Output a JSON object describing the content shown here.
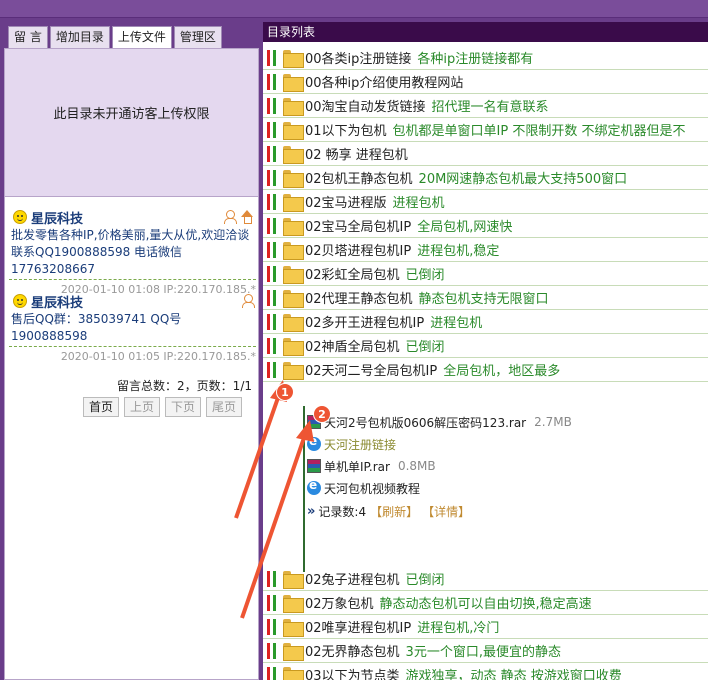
{
  "tabs": [
    {
      "label": "留 言"
    },
    {
      "label": "增加目录"
    },
    {
      "label": "上传文件"
    },
    {
      "label": "管理区"
    }
  ],
  "upload_message": "此目录未开通访客上传权限",
  "messages": [
    {
      "author": "星辰科技",
      "lines": [
        "批发零售各种IP,价格美丽,量大从优,欢迎洽谈",
        "联系QQ1900888598  电话微信17763208667"
      ],
      "meta": "2020-01-10 01:08 IP:220.170.185.*"
    },
    {
      "author": "星辰科技",
      "lines": [
        "售后QQ群：385039741  QQ号1900888598"
      ],
      "meta": "2020-01-10 01:05 IP:220.170.185.*"
    }
  ],
  "stats": "留言总数：2，页数：1/1",
  "pager": {
    "first": "首页",
    "prev": "上页",
    "next": "下页",
    "last": "尾页"
  },
  "right_title": "目录列表",
  "directories": [
    {
      "name": "00各类ip注册链接",
      "desc": "各种ip注册链接都有"
    },
    {
      "name": "00各种ip介绍使用教程网站",
      "desc": ""
    },
    {
      "name": "00淘宝自动发货链接",
      "desc": "招代理一名有意联系"
    },
    {
      "name": "01以下为包机",
      "desc": "包机都是单窗口单IP 不限制开数 不绑定机器但是不"
    },
    {
      "name": "02 畅享 进程包机",
      "desc": ""
    },
    {
      "name": "02包机王静态包机",
      "desc": "20M网速静态包机最大支持500窗口"
    },
    {
      "name": "02宝马进程版",
      "desc": "进程包机"
    },
    {
      "name": "02宝马全局包机IP",
      "desc": "全局包机,网速快"
    },
    {
      "name": "02贝塔进程包机IP",
      "desc": "进程包机,稳定"
    },
    {
      "name": "02彩虹全局包机",
      "desc": "已倒闭"
    },
    {
      "name": "02代理王静态包机",
      "desc": "静态包机支持无限窗口"
    },
    {
      "name": "02多开王进程包机IP",
      "desc": "进程包机"
    },
    {
      "name": "02神盾全局包机",
      "desc": "已倒闭"
    },
    {
      "name": "02天河二号全局包机IP",
      "desc": "全局包机，地区最多"
    }
  ],
  "expanded_files": [
    {
      "name": "天河2号包机版0606解压密码123.rar",
      "size": "2.7MB",
      "icon": "rar-icon"
    },
    {
      "name": "天河注册链接",
      "size": "",
      "icon": "ie-icon"
    },
    {
      "name": "单机单IP.rar",
      "size": "0.8MB",
      "icon": "rar-icon"
    },
    {
      "name": "天河包机视频教程",
      "size": "",
      "icon": "ie-icon"
    }
  ],
  "record": {
    "text": "记录数:4",
    "refresh": "【刷新】",
    "detail": "【详情】"
  },
  "directories2": [
    {
      "name": "02兔子进程包机",
      "desc": "已倒闭"
    },
    {
      "name": "02万象包机",
      "desc": "静态动态包机可以自由切换,稳定高速"
    },
    {
      "name": "02唯享进程包机IP",
      "desc": "进程包机,冷门"
    },
    {
      "name": "02无界静态包机",
      "desc": "3元一个窗口,最便宜的静态"
    },
    {
      "name": "03以下为节点类",
      "desc": "游戏独享，动态 静态 按游戏窗口收费"
    }
  ],
  "badges": {
    "one": "1",
    "two": "2"
  },
  "colors": {
    "accent": "#6a3d8a",
    "title_bar": "#3a0b4a",
    "desc_green": "#2a8a2a",
    "arrow_red": "#e53"
  }
}
